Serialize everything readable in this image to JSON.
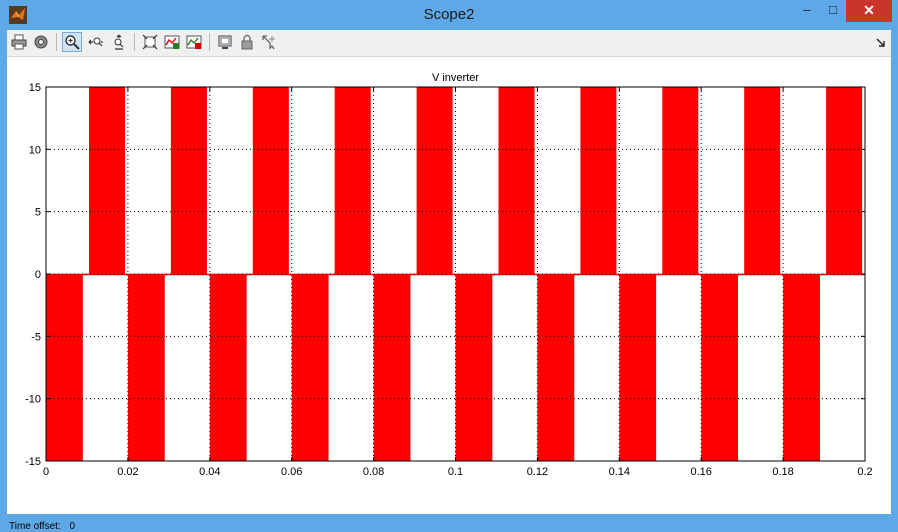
{
  "window": {
    "title": "Scope2"
  },
  "controls": {
    "minimize": "–",
    "maximize": "□",
    "close": "✕"
  },
  "toolbar": {
    "buttons": [
      {
        "name": "print-icon"
      },
      {
        "name": "parameters-icon"
      },
      {
        "name": "zoom-in-icon",
        "active": true
      },
      {
        "name": "zoom-x-icon"
      },
      {
        "name": "zoom-y-icon"
      },
      {
        "name": "autoscale-icon"
      },
      {
        "name": "save-axes-icon"
      },
      {
        "name": "restore-axes-icon"
      },
      {
        "name": "floating-scope-icon"
      },
      {
        "name": "lock-axes-icon"
      },
      {
        "name": "signal-selection-icon"
      }
    ]
  },
  "status": {
    "time_offset_label": "Time offset:",
    "time_offset_value": "0"
  },
  "colors": {
    "signal": "#ff0000",
    "titlebar": "#5ea8e8",
    "close": "#c7352b"
  },
  "chart_data": {
    "type": "line",
    "title": "V inverter",
    "xlabel": "",
    "ylabel": "",
    "xlim": [
      0,
      0.2
    ],
    "ylim": [
      -15,
      15
    ],
    "xticks": [
      0,
      0.02,
      0.04,
      0.06,
      0.08,
      0.1,
      0.12,
      0.14,
      0.16,
      0.18,
      0.2
    ],
    "xtick_labels": [
      "0",
      "0.02",
      "0.04",
      "0.06",
      "0.08",
      "0.1",
      "0.12",
      "0.14",
      "0.16",
      "0.18",
      "0.2"
    ],
    "yticks": [
      -15,
      -10,
      -5,
      0,
      5,
      10,
      15
    ],
    "ytick_labels": [
      "-15",
      "-10",
      "-5",
      "0",
      "5",
      "10",
      "15"
    ],
    "grid": true,
    "signal_description": "PWM inverter output switching between 0 and ±15 (dense switching renders as solid bands)",
    "series": [
      {
        "color": "#ff0000",
        "negative_bands": [
          [
            0.0,
            0.009
          ],
          [
            0.02,
            0.029
          ],
          [
            0.04,
            0.049
          ],
          [
            0.06,
            0.069
          ],
          [
            0.08,
            0.089
          ],
          [
            0.1,
            0.109
          ],
          [
            0.12,
            0.129
          ],
          [
            0.14,
            0.149
          ],
          [
            0.16,
            0.169
          ],
          [
            0.18,
            0.189
          ]
        ],
        "positive_bands": [
          [
            0.0105,
            0.0193
          ],
          [
            0.0305,
            0.0393
          ],
          [
            0.0505,
            0.0593
          ],
          [
            0.0705,
            0.0793
          ],
          [
            0.0905,
            0.0993
          ],
          [
            0.1105,
            0.1193
          ],
          [
            0.1305,
            0.1393
          ],
          [
            0.1505,
            0.1593
          ],
          [
            0.1705,
            0.1793
          ],
          [
            0.1905,
            0.1993
          ]
        ],
        "amplitude": 15
      }
    ]
  }
}
